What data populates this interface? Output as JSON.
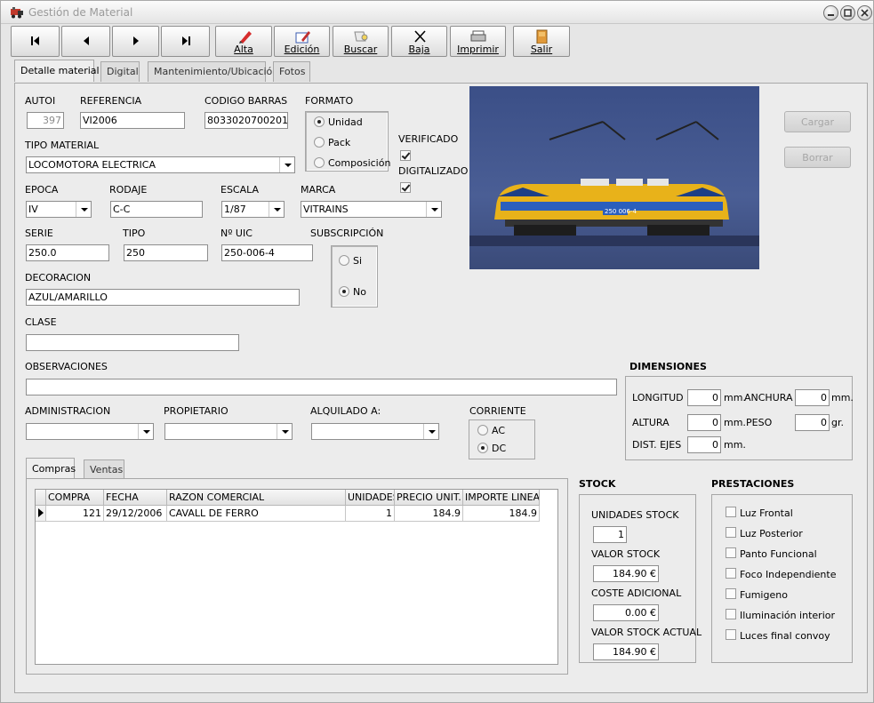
{
  "window": {
    "title": "Gestión de Material"
  },
  "toolbar": {
    "alta": "Alta",
    "edicion": "Edición",
    "buscar": "Buscar",
    "baja": "Baja",
    "imprimir": "Imprimir",
    "salir": "Salir"
  },
  "tabs": [
    "Detalle material",
    "Digital",
    "Mantenimiento/Ubicación",
    "Fotos"
  ],
  "form": {
    "autoi_label": "AUTOI",
    "autoi_value": "397",
    "referencia_label": "REFERENCIA",
    "referencia_value": "VI2006",
    "codigo_label": "CODIGO BARRAS",
    "codigo_value": "8033020700201",
    "formato_label": "FORMATO",
    "formato_options": [
      "Unidad",
      "Pack",
      "Composición"
    ],
    "tipo_material_label": "TIPO MATERIAL",
    "tipo_material_value": "LOCOMOTORA ELECTRICA",
    "verificado_label": "VERIFICADO",
    "digitalizado_label": "DIGITALIZADO",
    "epoca_label": "EPOCA",
    "epoca_value": "IV",
    "rodaje_label": "RODAJE",
    "rodaje_value": "C-C",
    "escala_label": "ESCALA",
    "escala_value": "1/87",
    "marca_label": "MARCA",
    "marca_value": "VITRAINS",
    "serie_label": "SERIE",
    "serie_value": "250.0",
    "tipo_label": "TIPO",
    "tipo_value": "250",
    "uic_label": "Nº UIC",
    "uic_value": "250-006-4",
    "subscripcion_label": "SUBSCRIPCIÓN",
    "subscripcion_options": [
      "Si",
      "No"
    ],
    "decoracion_label": "DECORACION",
    "decoracion_value": "AZUL/AMARILLO",
    "clase_label": "CLASE",
    "clase_value": "",
    "observaciones_label": "OBSERVACIONES",
    "observaciones_value": "",
    "administracion_label": "ADMINISTRACION",
    "propietario_label": "PROPIETARIO",
    "alquilado_label": "ALQUILADO A:",
    "corriente_label": "CORRIENTE",
    "corriente_options": [
      "AC",
      "DC"
    ]
  },
  "image_buttons": {
    "cargar": "Cargar",
    "borrar": "Borrar"
  },
  "dimensiones": {
    "title": "DIMENSIONES",
    "longitud_label": "LONGITUD",
    "longitud_value": "0",
    "longitud_unit": "mm.",
    "anchura_label": "ANCHURA",
    "anchura_value": "0",
    "anchura_unit": "mm.",
    "altura_label": "ALTURA",
    "altura_value": "0",
    "altura_unit": "mm.",
    "peso_label": "PESO",
    "peso_value": "0",
    "peso_unit": "gr.",
    "ejes_label": "DIST. EJES",
    "ejes_value": "0",
    "ejes_unit": "mm."
  },
  "subtabs": [
    "Compras",
    "Ventas"
  ],
  "grid": {
    "columns": [
      "COMPRA",
      "FECHA",
      "RAZON COMERCIAL",
      "UNIDADES",
      "PRECIO UNIT.",
      "IMPORTE LINEA"
    ],
    "row": [
      "121",
      "29/12/2006",
      "CAVALL DE FERRO",
      "1",
      "184.9",
      "184.9"
    ]
  },
  "stock": {
    "title": "STOCK",
    "unidades_label": "UNIDADES STOCK",
    "unidades_value": "1",
    "valor_label": "VALOR STOCK",
    "valor_value": "184.90 €",
    "coste_label": "COSTE ADICIONAL",
    "coste_value": "0.00 €",
    "actual_label": "VALOR STOCK ACTUAL",
    "actual_value": "184.90 €"
  },
  "prestaciones": {
    "title": "PRESTACIONES",
    "items": [
      "Luz Frontal",
      "Luz Posterior",
      "Panto Funcional",
      "Foco Independiente",
      "Fumigeno",
      "Iluminación interior",
      "Luces final convoy"
    ]
  },
  "locomotive": {
    "number_plate": "250 006-4"
  }
}
